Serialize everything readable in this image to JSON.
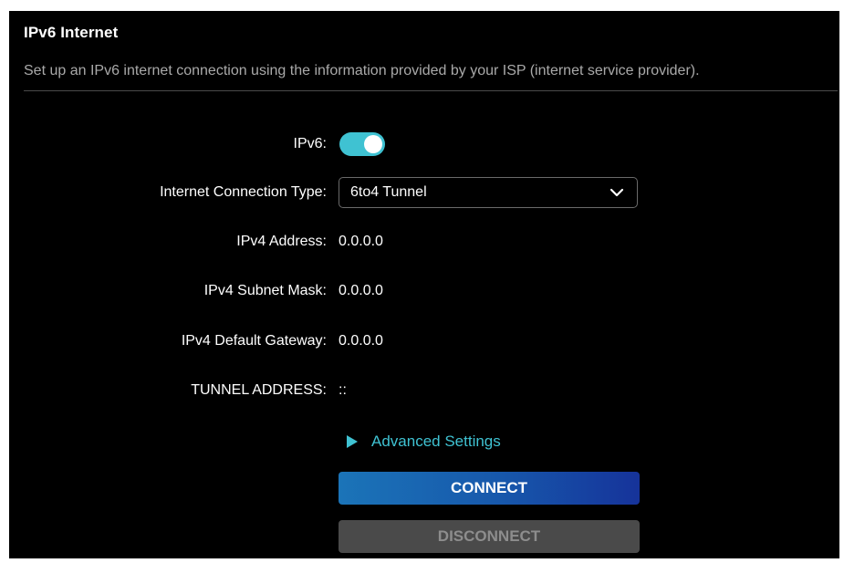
{
  "section": {
    "title": "IPv6 Internet",
    "description": "Set up an IPv6 internet connection using the information provided by your ISP (internet service provider)."
  },
  "fields": {
    "ipv6": {
      "label": "IPv6:",
      "enabled": true
    },
    "connection_type": {
      "label": "Internet Connection Type:",
      "value": "6to4 Tunnel"
    },
    "ipv4_address": {
      "label": "IPv4 Address:",
      "value": "0.0.0.0"
    },
    "ipv4_subnet_mask": {
      "label": "IPv4 Subnet Mask:",
      "value": "0.0.0.0"
    },
    "ipv4_default_gateway": {
      "label": "IPv4 Default Gateway:",
      "value": "0.0.0.0"
    },
    "tunnel_address": {
      "label": "TUNNEL ADDRESS:",
      "value": "::"
    }
  },
  "advanced": {
    "label": "Advanced Settings"
  },
  "buttons": {
    "connect": "CONNECT",
    "disconnect": "DISCONNECT"
  },
  "colors": {
    "accent": "#3fc2d2",
    "background": "#000000",
    "connect_start": "#1b74b8",
    "connect_end": "#16339a",
    "disabled_button": "#4a4a4a"
  },
  "icons": {
    "dropdown": "chevron-down-icon",
    "advanced": "triangle-right-icon"
  }
}
